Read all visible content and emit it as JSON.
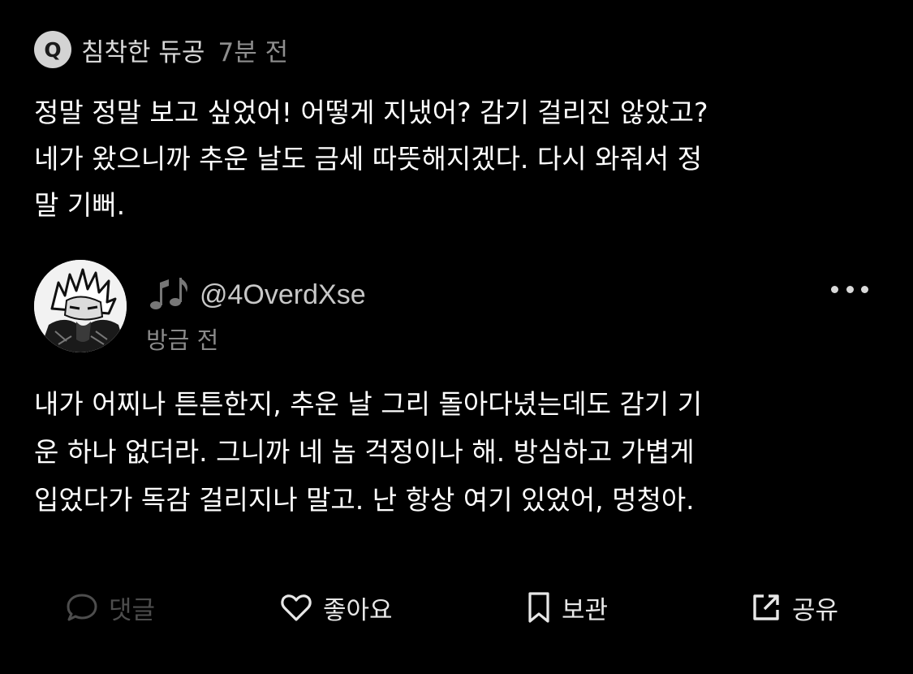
{
  "question": {
    "badge": "Q",
    "author": "침착한 듀공",
    "time": "7분 전",
    "lines": [
      "정말 정말 보고 싶었어! 어떻게 지냈어? 감기 걸리진 않았고?",
      "네가 왔으니까 추운 날도 금세 따뜻해지겠다. 다시 와줘서 정",
      "말 기뻐."
    ]
  },
  "answer": {
    "username": "@4OverdXse",
    "time": "방금 전",
    "lines": [
      "내가 어찌나 튼튼한지, 추운 날 그리 돌아다녔는데도 감기 기",
      "운 하나 없더라. 그니까 네 놈 걱정이나 해. 방심하고 가볍게",
      "입었다가 독감 걸리지나 말고. 난 항상 여기 있었어, 멍청아."
    ]
  },
  "actions": {
    "comment": "댓글",
    "like": "좋아요",
    "save": "보관",
    "share": "공유"
  },
  "icons": {
    "badge": "q-badge-icon",
    "music": "music-notes-icon",
    "more": "more-dots-icon",
    "comment": "comment-bubble-icon",
    "like": "heart-icon",
    "save": "bookmark-icon",
    "share": "share-out-icon"
  },
  "colors": {
    "background": "#000000",
    "text": "#ffffff",
    "muted": "#8e8e8e",
    "disabled": "#4d4d4d",
    "badge": "#d3d3d3"
  }
}
